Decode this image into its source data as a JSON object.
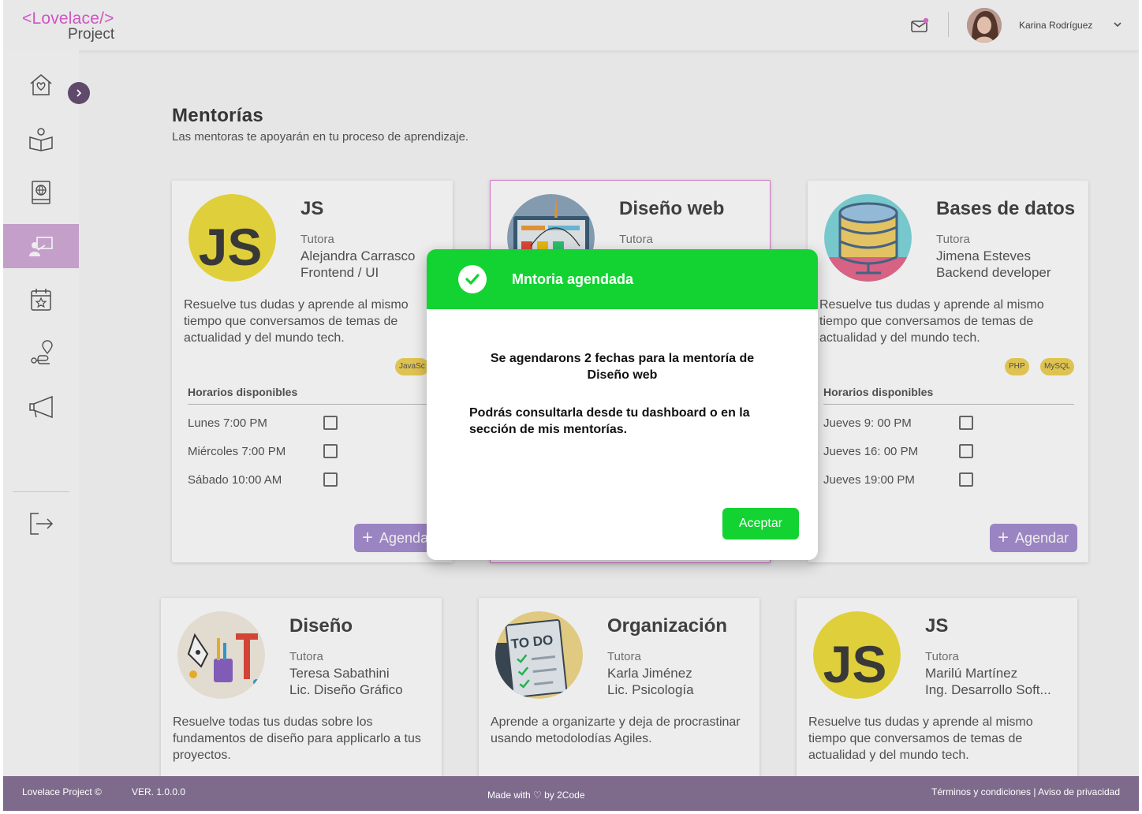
{
  "header": {
    "logo_top": "<Lovelace/>",
    "logo_bottom": "Project",
    "user_name": "Karina Rodríguez"
  },
  "sidebar": {
    "items": [
      {
        "icon": "home-heart-icon"
      },
      {
        "icon": "reading-book-icon"
      },
      {
        "icon": "globe-book-icon"
      },
      {
        "icon": "mentor-board-icon",
        "active": true
      },
      {
        "icon": "calendar-star-icon"
      },
      {
        "icon": "route-pin-icon"
      },
      {
        "icon": "megaphone-icon"
      },
      {
        "icon": "logout-icon"
      }
    ]
  },
  "page": {
    "title": "Mentorías",
    "subtitle": "Las mentoras te apoyarán en tu proceso de aprendizaje."
  },
  "common": {
    "role": "Tutora",
    "schedule_title": "Horarios disponibles",
    "book_label": "Agendar"
  },
  "cards": [
    {
      "title": "JS",
      "mentor": "Alejandra Carrasco",
      "spec": "Frontend / UI",
      "desc": "Resuelve tus dudas y aprende al mismo tiempo que conversamos de temas de actualidad y del mundo tech.",
      "tags": [
        "JavaSc"
      ],
      "slots": [
        "Lunes 7:00 PM",
        "Miércoles 7:00 PM",
        "Sábado 10:00 AM"
      ]
    },
    {
      "title": "Diseño web",
      "mentor": "",
      "spec": "",
      "desc": "",
      "tags": [],
      "slots": []
    },
    {
      "title": "Bases de datos",
      "mentor": "Jimena Esteves",
      "spec": "Backend developer",
      "desc": "Resuelve tus dudas y aprende al mismo tiempo que conversamos de temas de actualidad y del mundo tech.",
      "tags": [
        "PHP",
        "MySQL"
      ],
      "slots": [
        "Jueves 9: 00 PM",
        "Jueves 16: 00 PM",
        "Jueves 19:00 PM"
      ]
    },
    {
      "title": "Diseño",
      "mentor": "Teresa Sabathini",
      "spec": "Lic. Diseño Gráfico",
      "desc": "Resuelve todas tus dudas sobre los fundamentos de diseño para applicarlo a tus proyectos."
    },
    {
      "title": "Organización",
      "mentor": "Karla Jiménez",
      "spec": "Lic. Psicología",
      "desc": "Aprende a organizarte y deja de procrastinar usando metodolodías Agiles."
    },
    {
      "title": "JS",
      "mentor": "Marilú Martínez",
      "spec": "Ing. Desarrollo Soft...",
      "desc": "Resuelve tus dudas y aprende al mismo tiempo que conversamos de temas de actualidad y del mundo tech."
    }
  ],
  "modal": {
    "title": "Mntoria agendada",
    "line1": "Se agendarons 2 fechas para la mentoría de Diseño web",
    "line2": "Podrás consultarla desde tu dashboard o en la sección de mis mentorías.",
    "accept": "Aceptar"
  },
  "footer": {
    "left": "Lovelace Project ©",
    "version": "VER. 1.0.0.0",
    "center": "Made with ♡ by 2Code",
    "right": "Términos y condiciones | Aviso de privacidad"
  },
  "colors": {
    "accent_purple": "#a78ed1",
    "active_nav": "#d3acd9",
    "footer": "#7e6b8c",
    "success": "#12d332",
    "logo_pink": "#e05bd0",
    "tag_yellow": "#f0d257"
  }
}
